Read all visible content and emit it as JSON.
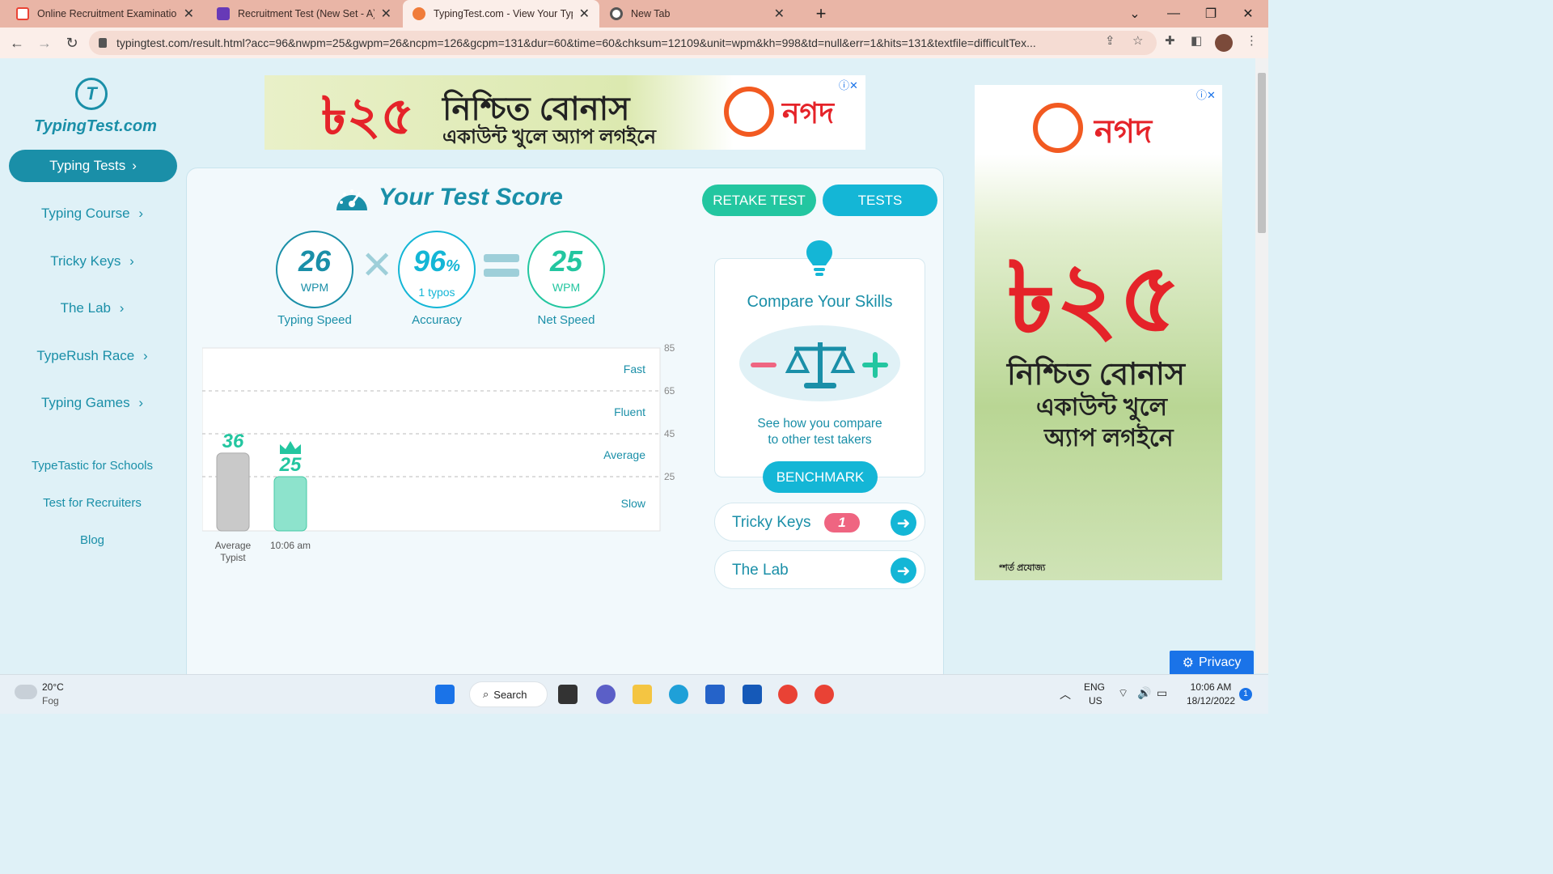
{
  "browser": {
    "tabs": [
      {
        "title": "Online Recruitment Examination",
        "icon": "gmail-icon",
        "color": "#ea4335"
      },
      {
        "title": "Recruitment Test (New Set - A)",
        "icon": "forms-icon",
        "color": "#673ab7"
      },
      {
        "title": "TypingTest.com - View Your Typing",
        "icon": "typingtest-favicon",
        "color": "#f07c3a"
      },
      {
        "title": "New Tab",
        "icon": "chrome-icon",
        "color": "#555555"
      }
    ],
    "url": "typingtest.com/result.html?acc=96&nwpm=25&gwpm=26&ncpm=126&gcpm=131&dur=60&time=60&chksum=12109&unit=wpm&kh=998&td=null&err=1&hits=131&textfile=difficultTex..."
  },
  "sidebar": {
    "logo": "TypingTest.com",
    "items": [
      {
        "label": "Typing Tests",
        "active": true
      },
      {
        "label": "Typing Course"
      },
      {
        "label": "Tricky Keys"
      },
      {
        "label": "The Lab"
      },
      {
        "label": "TypeRush Race"
      },
      {
        "label": "Typing Games"
      }
    ],
    "links": [
      "TypeTastic for Schools",
      "Test for Recruiters",
      "Blog"
    ]
  },
  "ads": {
    "amount": "৳২৫",
    "headline": "নিশ্চিত বোনাস",
    "subline": "একাউন্ট খুলে অ্যাপ লগইনে",
    "side_line1": "একাউন্ট খুলে",
    "side_line2": "অ্যাপ লগইনে",
    "brand": "নগদ",
    "terms": "*শর্ত প্রযোজ্য"
  },
  "result": {
    "title": "Your Test Score",
    "retake_label": "RETAKE TEST",
    "tests_label": "TESTS",
    "typing_speed": {
      "value": "26",
      "unit": "WPM",
      "label": "Typing Speed"
    },
    "accuracy": {
      "value": "96",
      "pct": "%",
      "typos": "1  typos",
      "label": "Accuracy"
    },
    "net_speed": {
      "value": "25",
      "unit": "WPM",
      "label": "Net Speed"
    }
  },
  "chart_data": {
    "type": "bar",
    "categories": [
      "Average\nTypist",
      "10:06 am"
    ],
    "values": [
      36,
      25
    ],
    "value_labels": [
      "36",
      "25"
    ],
    "yticks": [
      85,
      65,
      45,
      25
    ],
    "bands": [
      "Fast",
      "Fluent",
      "Average",
      "Slow"
    ],
    "colors": [
      "#c9c9c9",
      "#8de3cc"
    ],
    "ylim": [
      0,
      85
    ]
  },
  "compare": {
    "title": "Compare Your Skills",
    "desc_line1": "See how you compare",
    "desc_line2": "to other test takers",
    "benchmark_label": "BENCHMARK",
    "tricky_keys_label": "Tricky Keys",
    "tricky_keys_count": "1",
    "lab_label": "The Lab"
  },
  "privacy_label": "Privacy",
  "taskbar": {
    "weather_temp": "20°C",
    "weather_desc": "Fog",
    "search_label": "Search",
    "lang1": "ENG",
    "lang2": "US",
    "time": "10:06 AM",
    "date": "18/12/2022",
    "notif_count": "1"
  }
}
